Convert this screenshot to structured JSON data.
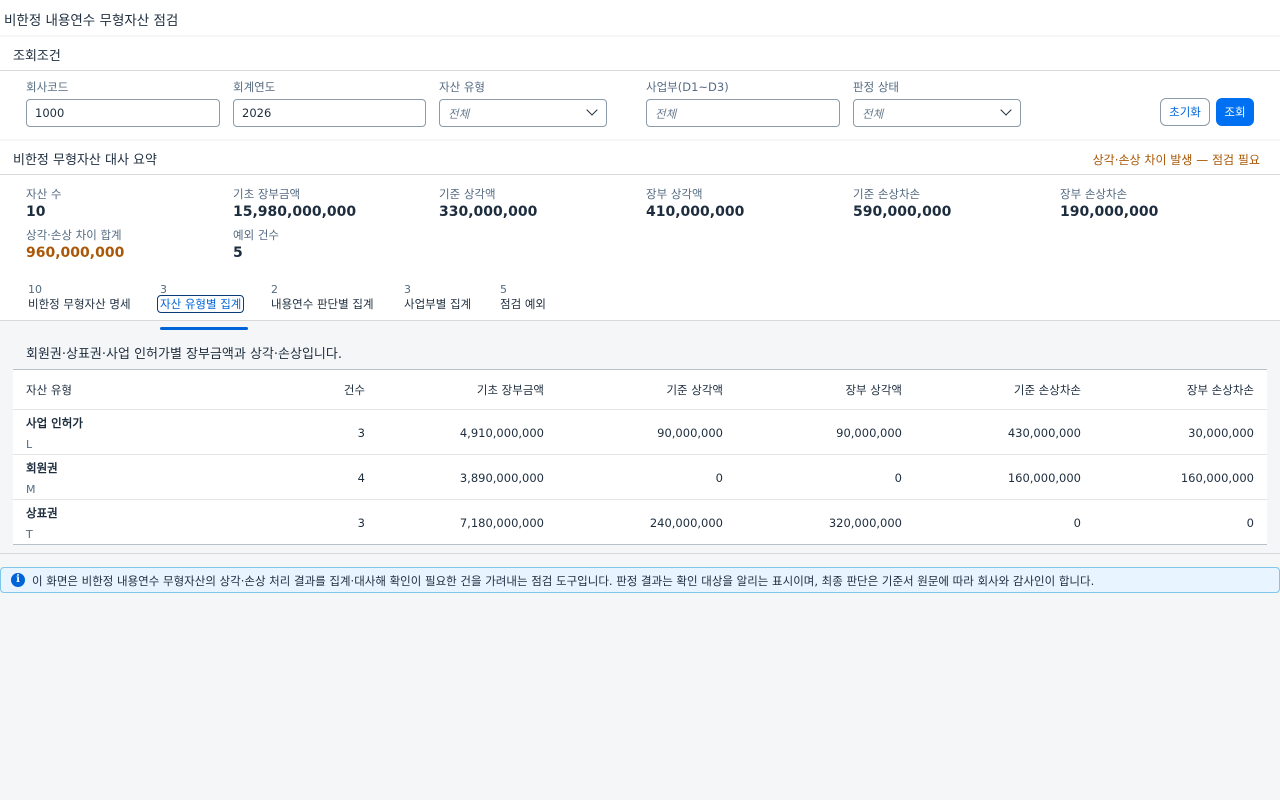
{
  "page": {
    "title": "비한정 내용연수 무형자산 점검"
  },
  "filters": {
    "section_title": "조회조건",
    "company_code": {
      "label": "회사코드",
      "value": "1000"
    },
    "fiscal_year": {
      "label": "회계연도",
      "value": "2026"
    },
    "asset_type": {
      "label": "자산 유형",
      "value": "전체"
    },
    "business_unit": {
      "label": "사업부(D1~D3)",
      "placeholder": "전체"
    },
    "judgement_status": {
      "label": "판정 상태",
      "value": "전체"
    },
    "reset_label": "초기화",
    "search_label": "조회"
  },
  "summary": {
    "section_title": "비한정 무형자산 대사 요약",
    "warning": "상각·손상 차이 발생 — 점검 필요",
    "kpis": [
      {
        "label": "자산 수",
        "value": "10"
      },
      {
        "label": "기초 장부금액",
        "value": "15,980,000,000"
      },
      {
        "label": "기준 상각액",
        "value": "330,000,000"
      },
      {
        "label": "장부 상각액",
        "value": "410,000,000"
      },
      {
        "label": "기준 손상차손",
        "value": "590,000,000"
      },
      {
        "label": "장부 손상차손",
        "value": "190,000,000"
      },
      {
        "label": "상각·손상 차이 합계",
        "value": "960,000,000"
      },
      {
        "label": "예외 건수",
        "value": "5"
      }
    ]
  },
  "tabs": [
    {
      "count": "10",
      "label": "비한정 무형자산 명세"
    },
    {
      "count": "3",
      "label": "자산 유형별 집계"
    },
    {
      "count": "2",
      "label": "내용연수 판단별 집계"
    },
    {
      "count": "3",
      "label": "사업부별 집계"
    },
    {
      "count": "5",
      "label": "점검 예외"
    }
  ],
  "main": {
    "description": "회원권·상표권·사업 인허가별 장부금액과 상각·손상입니다.",
    "table": {
      "headers": [
        "자산 유형",
        "건수",
        "기초 장부금액",
        "기준 상각액",
        "장부 상각액",
        "기준 손상차손",
        "장부 손상차손"
      ],
      "rows": [
        {
          "name": "사업 인허가",
          "code": "L",
          "count": "3",
          "opening": "4,910,000,000",
          "std_amort": "90,000,000",
          "book_amort": "90,000,000",
          "std_impair": "430,000,000",
          "book_impair": "30,000,000"
        },
        {
          "name": "회원권",
          "code": "M",
          "count": "4",
          "opening": "3,890,000,000",
          "std_amort": "0",
          "book_amort": "0",
          "std_impair": "160,000,000",
          "book_impair": "160,000,000"
        },
        {
          "name": "상표권",
          "code": "T",
          "count": "3",
          "opening": "7,180,000,000",
          "std_amort": "240,000,000",
          "book_amort": "320,000,000",
          "std_impair": "0",
          "book_impair": "0"
        }
      ]
    }
  },
  "info": {
    "icon": "info-icon",
    "text": "이 화면은 비한정 내용연수 무형자산의 상각·손상 처리 결과를 집계·대사해 확인이 필요한 건을 가려내는 점검 도구입니다. 판정 결과는 확인 대상을 알리는 표시이며, 최종 판단은 기준서 원문에 따라 회사와 감사인이 합니다."
  }
}
